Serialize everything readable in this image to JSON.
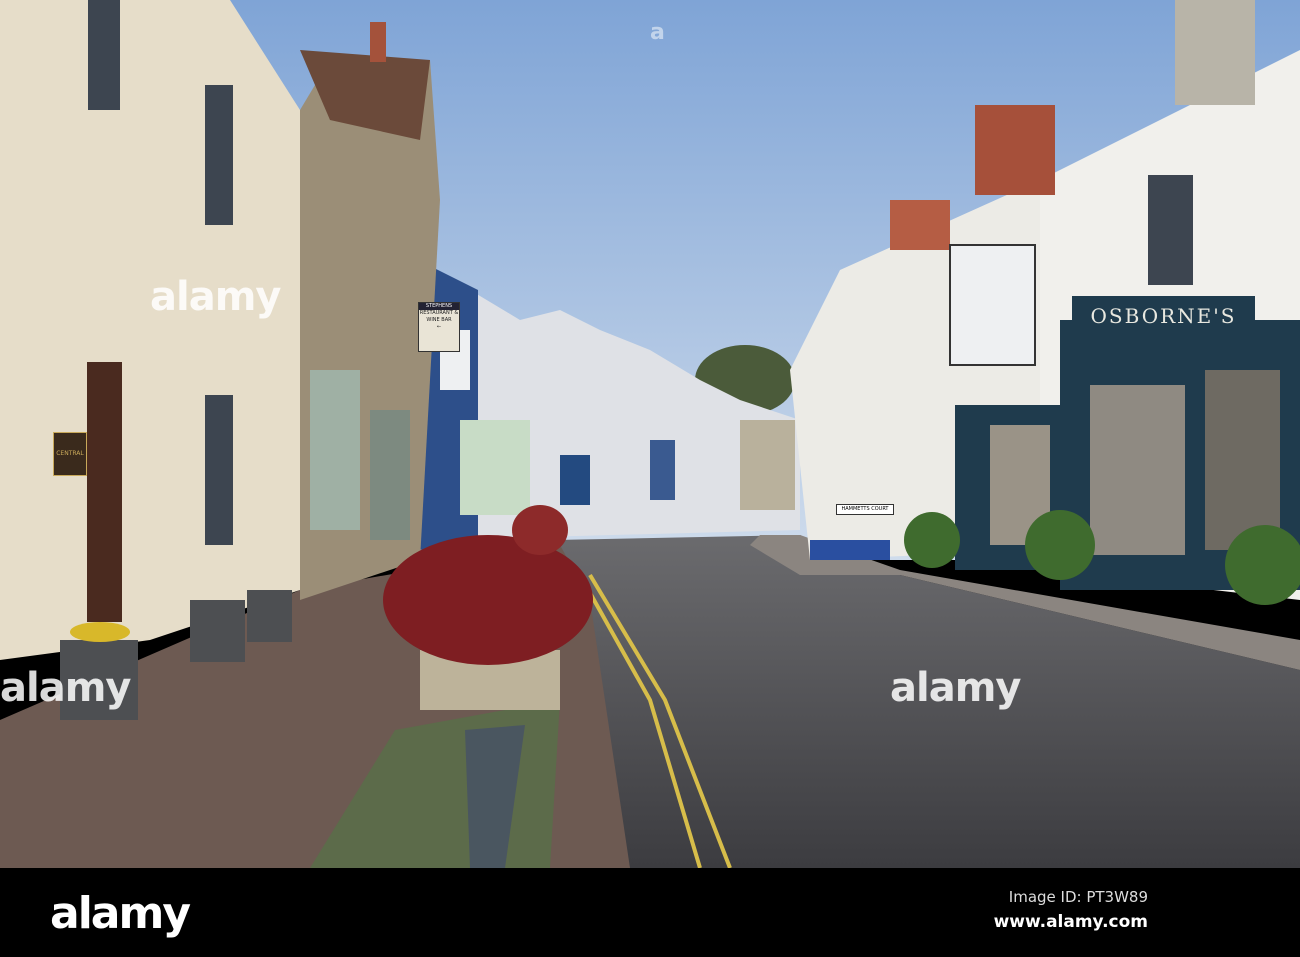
{
  "photo": {
    "subject": "Street scene",
    "signs": {
      "restaurant_name": "STEPHENS",
      "restaurant_line2": "RESTAURANT & WINE BAR",
      "shop_name": "OSBORNE'S",
      "street_sign": "HAMMETTS COURT",
      "house_plaque": "CENTRAL"
    },
    "watermarks": [
      "alamy",
      "alamy",
      "alamy",
      "a"
    ]
  },
  "footer": {
    "logo": "alamy",
    "image_id": "Image ID: PT3W89",
    "url": "www.alamy.com"
  }
}
